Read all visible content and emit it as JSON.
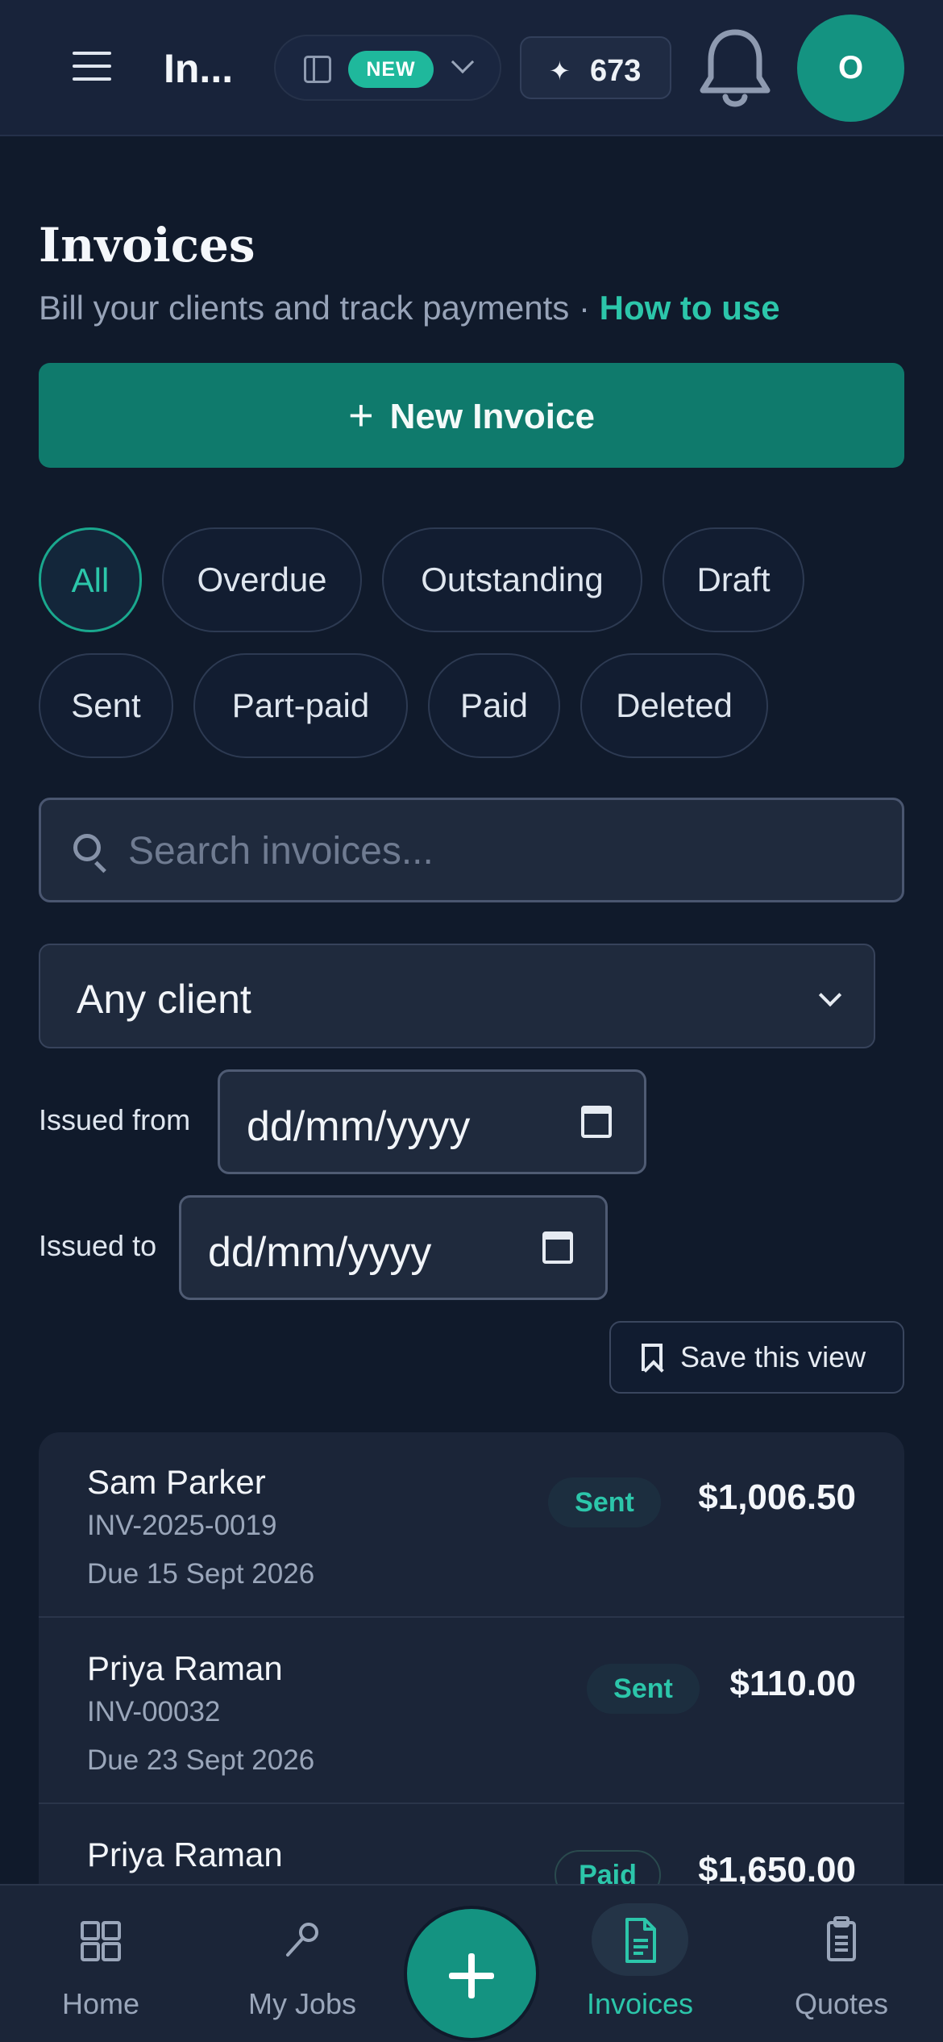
{
  "header": {
    "app_title": "In...",
    "new_badge": "NEW",
    "credits": "673",
    "avatar_initial": "O"
  },
  "page": {
    "title": "Invoices",
    "subtitle": "Bill your clients and track payments · ",
    "how_to_link": "How to use",
    "new_invoice_label": "New Invoice"
  },
  "filters": [
    {
      "label": "All",
      "active": true
    },
    {
      "label": "Overdue"
    },
    {
      "label": "Outstanding"
    },
    {
      "label": "Draft"
    },
    {
      "label": "Sent"
    },
    {
      "label": "Part-paid"
    },
    {
      "label": "Paid"
    },
    {
      "label": "Deleted"
    }
  ],
  "search": {
    "placeholder": "Search invoices..."
  },
  "client_select": {
    "value": "Any client"
  },
  "dates": {
    "from_label": "Issued from",
    "to_label": "Issued to",
    "placeholder": "dd/mm/yyyy"
  },
  "save_view_label": "Save this view",
  "invoices": [
    {
      "client": "Sam Parker",
      "number": "INV-2025-0019",
      "due": "Due 15 Sept 2026",
      "status": "Sent",
      "amount": "$1,006.50"
    },
    {
      "client": "Priya Raman",
      "number": "INV-00032",
      "due": "Due 23 Sept 2026",
      "status": "Sent",
      "amount": "$110.00"
    },
    {
      "client": "Priya Raman",
      "number": "",
      "due": "",
      "status": "Paid",
      "amount": "$1,650.00"
    }
  ],
  "bottom_nav": [
    {
      "label": "Home",
      "icon": "grid-icon"
    },
    {
      "label": "My Jobs",
      "icon": "wrench-icon"
    },
    {
      "label": "Invoices",
      "icon": "document-icon",
      "active": true
    },
    {
      "label": "Quotes",
      "icon": "clipboard-icon"
    }
  ],
  "colors": {
    "accent": "#1fb89c",
    "primary_button": "#0f7a6c",
    "background": "#101a2b"
  }
}
